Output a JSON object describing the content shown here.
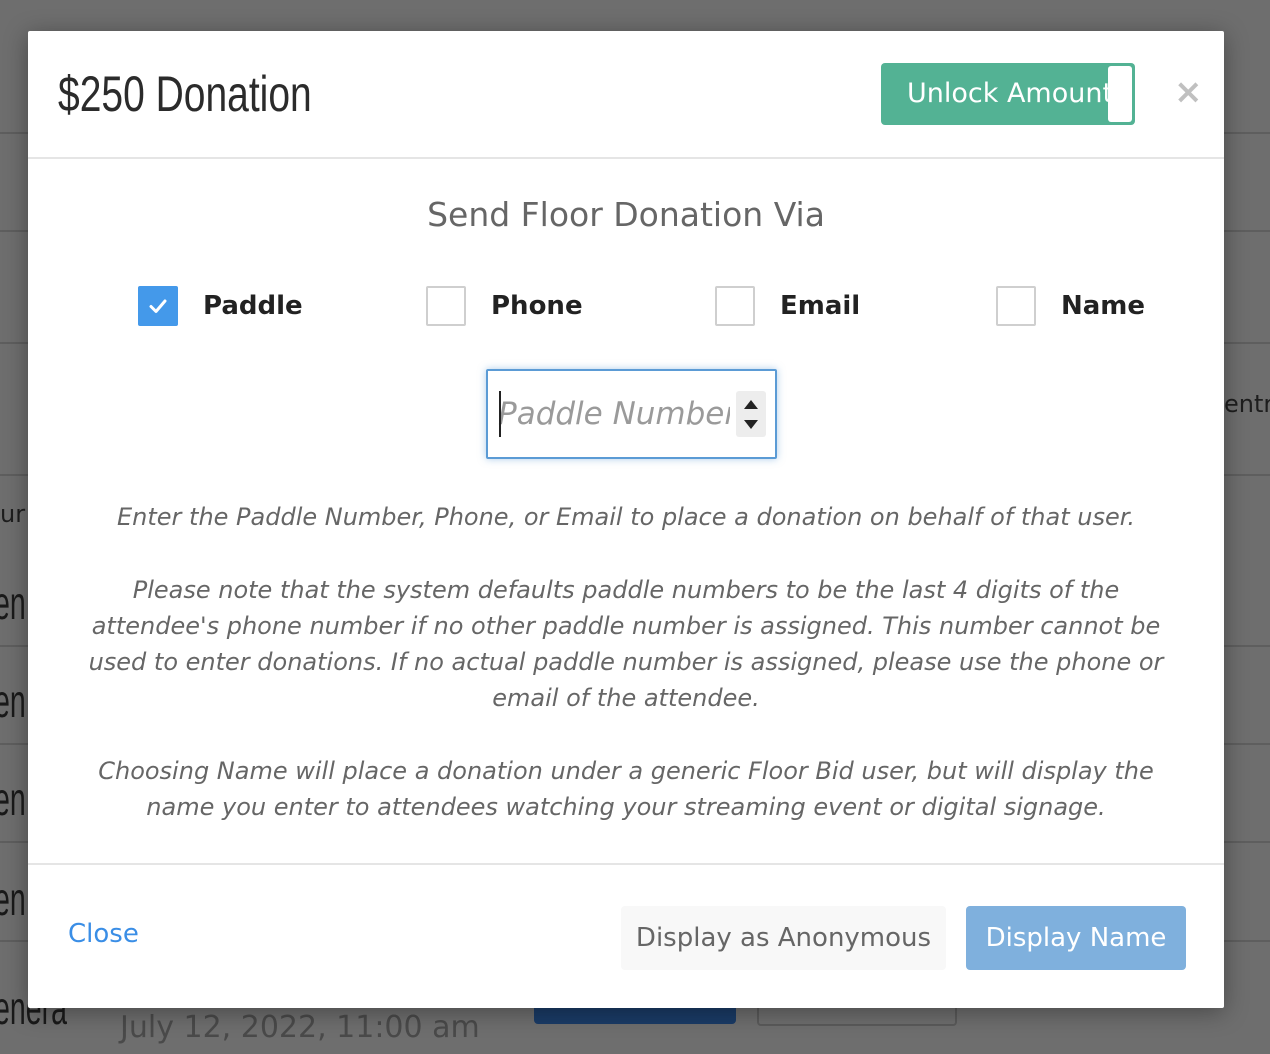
{
  "background": {
    "row_texts": [
      "en",
      "en",
      "en",
      "en",
      "enera"
    ],
    "side_text_left": "ur",
    "side_text_right": "entri",
    "bottom_fragment": "July 12, 2022, 11:00 am"
  },
  "modal": {
    "title": "$250 Donation",
    "unlock_label": "Unlock Amount",
    "close_symbol": "×",
    "section_title": "Send Floor Donation Via",
    "options": [
      {
        "label": "Paddle",
        "checked": true
      },
      {
        "label": "Phone",
        "checked": false
      },
      {
        "label": "Email",
        "checked": false
      },
      {
        "label": "Name",
        "checked": false
      }
    ],
    "input": {
      "placeholder": "Paddle Number",
      "value": ""
    },
    "help_paragraphs": [
      "Enter the Paddle Number, Phone, or Email to place a donation on behalf of that user.",
      "Please note that the system defaults paddle numbers to be the last 4 digits of the attendee's phone number if no other paddle number is assigned. This number cannot be used to enter donations. If no actual paddle number is assigned, please use the phone or email of the attendee.",
      "Choosing Name will place a donation under a generic Floor Bid user, but will display the name you enter to attendees watching your streaming event or digital signage."
    ],
    "footer": {
      "close_label": "Close",
      "anonymous_label": "Display as Anonymous",
      "display_name_label": "Display Name"
    }
  },
  "colors": {
    "accent_green": "#53b294",
    "checkbox_blue": "#4499ea",
    "link_blue": "#3a8ee6",
    "primary_button": "#7fb0dd"
  }
}
